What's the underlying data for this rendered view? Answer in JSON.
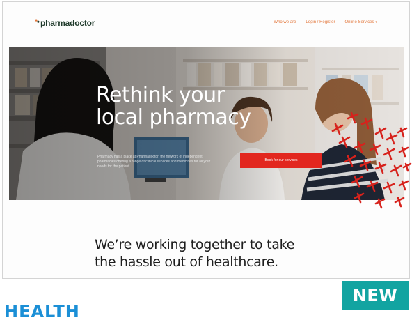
{
  "header": {
    "logo_text": "pharmadoctor",
    "nav": [
      {
        "label": "Who we are"
      },
      {
        "label": "Login / Register"
      },
      {
        "label": "Online Services",
        "has_dropdown": true
      }
    ]
  },
  "hero": {
    "title_line1": "Rethink your",
    "title_line2": "local pharmacy",
    "subtitle": "Pharmacy has a place at Pharmadoctor, the network of independent pharmacies offering a range of clinical services and medicines for all your needs for the patient.",
    "cta_label": "Book for our services"
  },
  "tagline": {
    "line1": "We’re working together to take",
    "line2": "the hassle out of healthcare."
  },
  "badge": {
    "label": "NEW"
  },
  "section_label": "HEALTH",
  "colors": {
    "accent": "#e3763a",
    "cta": "#e2271f",
    "badge": "#12a4a1",
    "section_label": "#1b8fd6",
    "logo": "#1f3a2b"
  }
}
